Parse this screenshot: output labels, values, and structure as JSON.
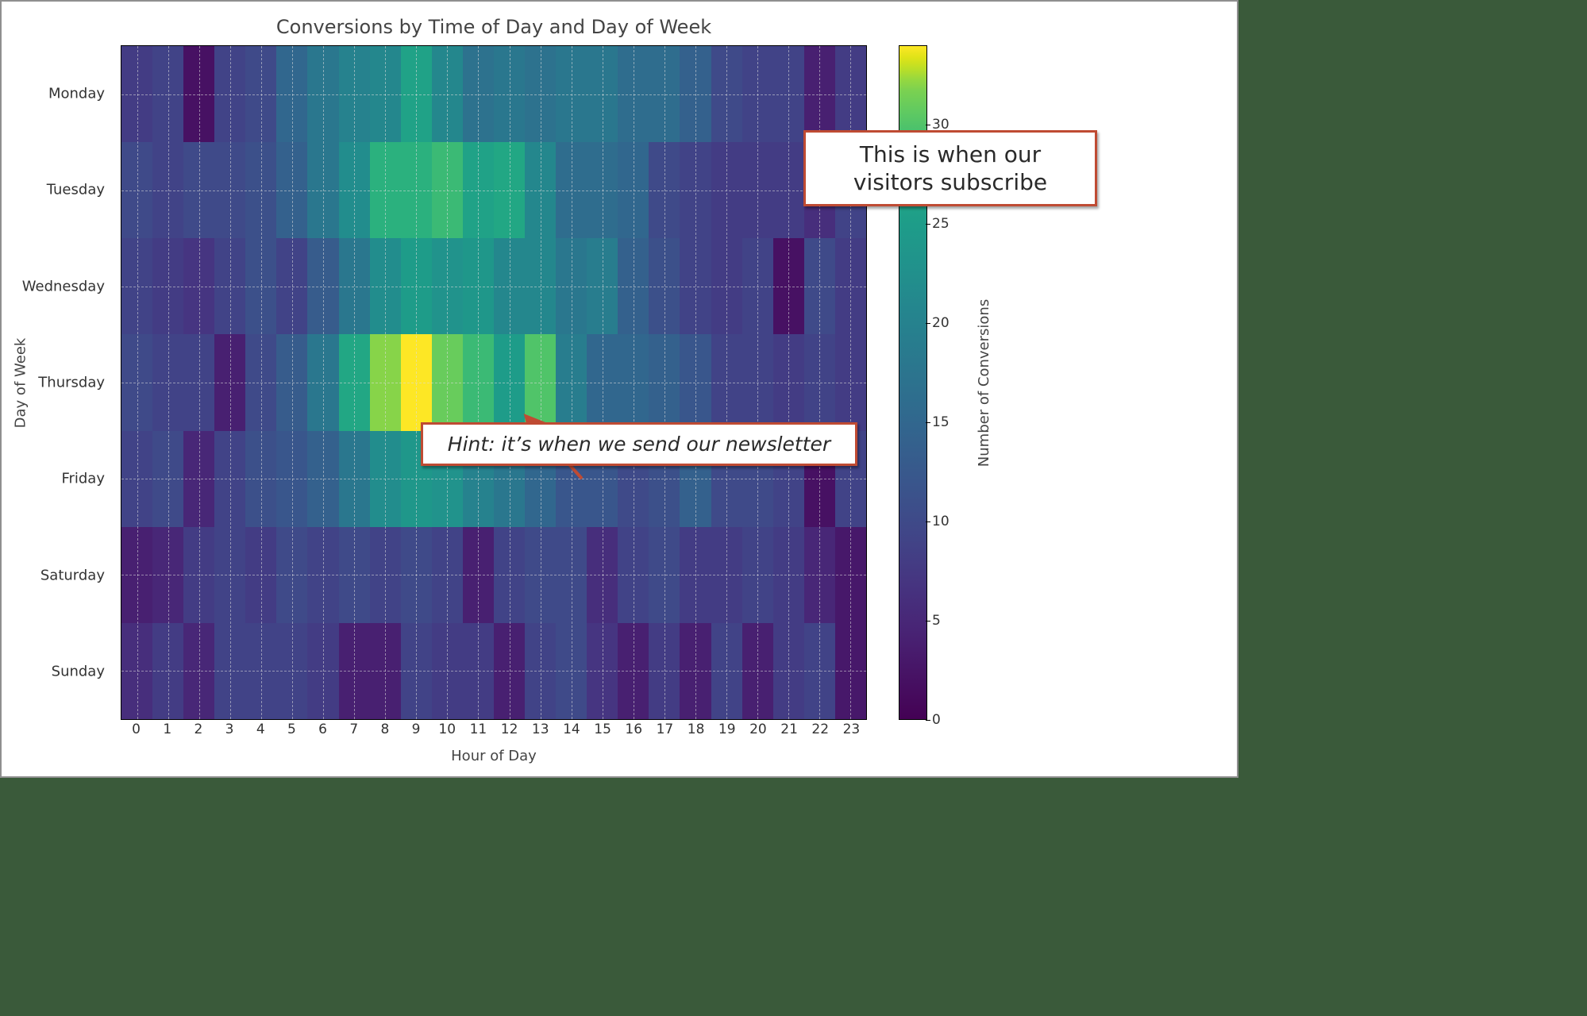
{
  "chart_data": {
    "type": "heatmap",
    "title": "Conversions by Time of Day and Day of Week",
    "xlabel": "Hour of Day",
    "ylabel": "Day of Week",
    "colorbar_label": "Number of Conversions",
    "x_categories": [
      "0",
      "1",
      "2",
      "3",
      "4",
      "5",
      "6",
      "7",
      "8",
      "9",
      "10",
      "11",
      "12",
      "13",
      "14",
      "15",
      "16",
      "17",
      "18",
      "19",
      "20",
      "21",
      "22",
      "23"
    ],
    "y_categories": [
      "Monday",
      "Tuesday",
      "Wednesday",
      "Thursday",
      "Friday",
      "Saturday",
      "Sunday"
    ],
    "colorbar_ticks": [
      0,
      5,
      10,
      15,
      20,
      25,
      30
    ],
    "vmin": 0,
    "vmax": 34,
    "values": [
      [
        8,
        9,
        2,
        9,
        10,
        15,
        18,
        20,
        21,
        26,
        21,
        17,
        18,
        17,
        18,
        18,
        16,
        16,
        14,
        10,
        9,
        9,
        4,
        8
      ],
      [
        10,
        9,
        10,
        10,
        11,
        14,
        18,
        22,
        28,
        28,
        29,
        26,
        27,
        21,
        16,
        16,
        15,
        10,
        9,
        8,
        8,
        8,
        6,
        9
      ],
      [
        9,
        8,
        7,
        9,
        11,
        9,
        13,
        18,
        22,
        25,
        23,
        24,
        21,
        21,
        18,
        19,
        14,
        11,
        9,
        8,
        9,
        2,
        10,
        8
      ],
      [
        10,
        9,
        9,
        4,
        10,
        13,
        18,
        27,
        32,
        34,
        31,
        29,
        25,
        30,
        19,
        15,
        15,
        14,
        12,
        9,
        9,
        8,
        9,
        8
      ],
      [
        9,
        10,
        5,
        9,
        11,
        12,
        14,
        18,
        22,
        24,
        23,
        20,
        18,
        15,
        12,
        12,
        10,
        11,
        14,
        10,
        10,
        9,
        2,
        9
      ],
      [
        4,
        5,
        8,
        9,
        8,
        10,
        9,
        10,
        9,
        10,
        9,
        4,
        9,
        10,
        10,
        6,
        9,
        10,
        8,
        8,
        9,
        8,
        5,
        3
      ],
      [
        6,
        8,
        5,
        9,
        9,
        9,
        8,
        4,
        4,
        9,
        8,
        8,
        4,
        9,
        10,
        7,
        4,
        8,
        4,
        9,
        4,
        8,
        9,
        3
      ]
    ],
    "annotations": [
      {
        "text": "This is when our visitors subscribe"
      },
      {
        "text": "Hint: it’s when we send our newsletter"
      }
    ]
  }
}
